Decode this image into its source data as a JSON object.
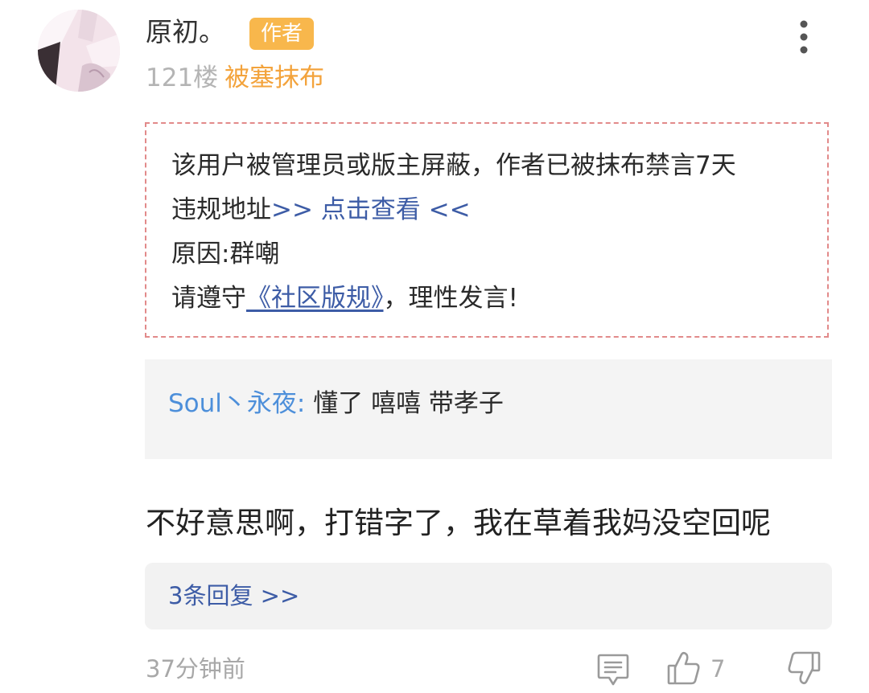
{
  "post": {
    "author": {
      "name": "原初。",
      "badge": "作者"
    },
    "floor": "121楼",
    "status_tag": "被塞抹布",
    "ban_notice": {
      "line1": "该用户被管理员或版主屏蔽，作者已被抹布禁言7天",
      "line2_prefix": "违规地址",
      "line2_link": ">> 点击查看 <<",
      "line3": "原因:群嘲",
      "line4_prefix": "请遵守",
      "line4_link": "《社区版规》",
      "line4_suffix": "，理性发言!"
    },
    "quote": {
      "user": "Soul丶永夜:",
      "text": "懂了  嘻嘻 带孝子"
    },
    "content": "不好意思啊，打错字了，我在草着我妈没空回呢",
    "replies_link": "3条回复 >>",
    "time": "37分钟前",
    "like_count": "7"
  },
  "icons": {
    "more": "more-vertical-icon",
    "comment": "comment-icon",
    "like": "thumbs-up-icon",
    "dislike": "thumbs-down-icon"
  },
  "colors": {
    "author_badge": "#f8b74c",
    "status_tag": "#f3a33c",
    "ban_border": "#e28a8a",
    "link": "#3d5ca6",
    "quote_user": "#4d8fda"
  }
}
